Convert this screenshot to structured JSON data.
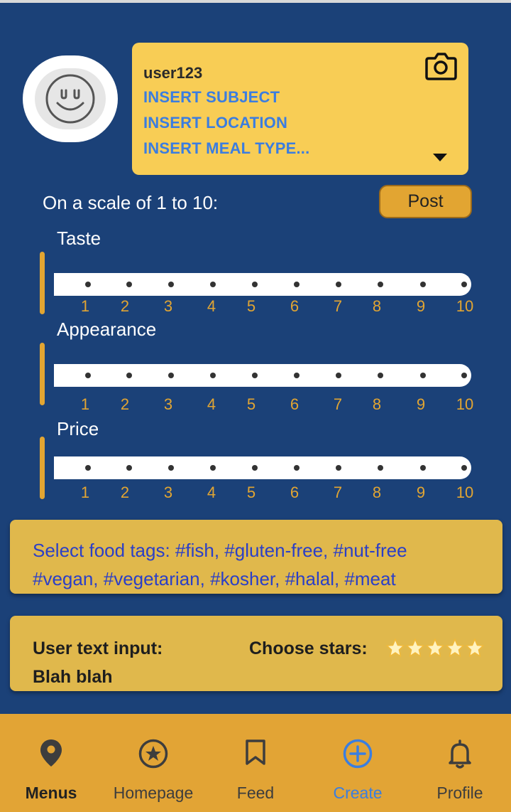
{
  "header": {
    "username": "user123",
    "subject": "INSERT SUBJECT",
    "location": "INSERT LOCATION",
    "meal_type": "INSERT MEAL TYPE..."
  },
  "scale_prompt": "On a scale of 1 to 10:",
  "post_label": "Post",
  "ratings": [
    {
      "title": "Taste",
      "ticks": [
        "1",
        "2",
        "3",
        "4",
        "5",
        "6",
        "7",
        "8",
        "9",
        "10"
      ]
    },
    {
      "title": "Appearance",
      "ticks": [
        "1",
        "2",
        "3",
        "4",
        "5",
        "6",
        "7",
        "8",
        "9",
        "10"
      ]
    },
    {
      "title": "Price",
      "ticks": [
        "1",
        "2",
        "3",
        "4",
        "5",
        "6",
        "7",
        "8",
        "9",
        "10"
      ]
    }
  ],
  "tags": {
    "line1": "Select food tags: #fish, #gluten-free, #nut-free",
    "line2": "#vegan, #vegetarian, #kosher, #halal, #meat"
  },
  "input": {
    "label": "User text input:",
    "value": "Blah blah",
    "stars_label": "Choose stars:"
  },
  "nav": [
    {
      "label": "Menus",
      "icon": "location-pin-icon"
    },
    {
      "label": "Homepage",
      "icon": "star-circle-icon"
    },
    {
      "label": "Feed",
      "icon": "bookmark-icon"
    },
    {
      "label": "Create",
      "icon": "plus-circle-icon"
    },
    {
      "label": "Profile",
      "icon": "bell-icon"
    }
  ],
  "colors": {
    "background": "#1b4178",
    "card": "#f8cd55",
    "accent": "#e2a532",
    "link_blue": "#3b7de0",
    "nav_active": "#3a7ee0"
  }
}
